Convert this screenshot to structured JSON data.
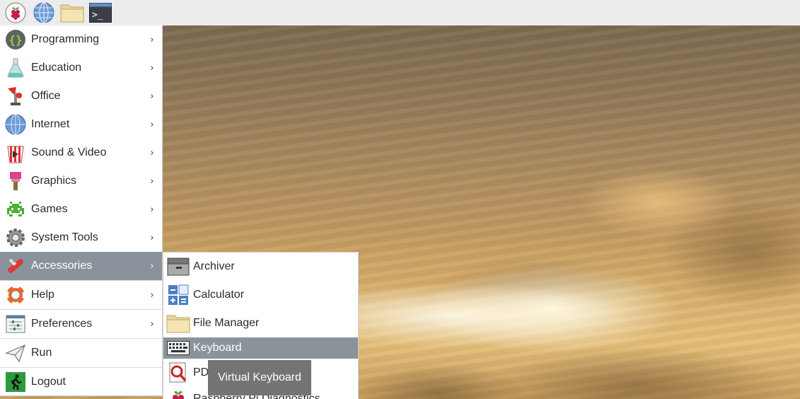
{
  "taskbar": {
    "launchers": [
      {
        "icon": "raspberry-menu-icon"
      },
      {
        "icon": "web-browser-icon"
      },
      {
        "icon": "file-manager-icon"
      },
      {
        "icon": "terminal-icon",
        "glyph": ">_"
      }
    ]
  },
  "menu": {
    "items": [
      {
        "label": "Programming",
        "icon": "programming-icon"
      },
      {
        "label": "Education",
        "icon": "education-icon"
      },
      {
        "label": "Office",
        "icon": "office-icon"
      },
      {
        "label": "Internet",
        "icon": "internet-icon"
      },
      {
        "label": "Sound & Video",
        "icon": "sound-video-icon"
      },
      {
        "label": "Graphics",
        "icon": "graphics-icon"
      },
      {
        "label": "Games",
        "icon": "games-icon"
      },
      {
        "label": "System Tools",
        "icon": "system-tools-icon"
      },
      {
        "label": "Accessories",
        "icon": "accessories-icon",
        "active": true
      },
      {
        "label": "Help",
        "icon": "help-icon"
      },
      {
        "label": "Preferences",
        "icon": "preferences-icon"
      },
      {
        "label": "Run",
        "icon": "run-icon"
      },
      {
        "label": "Logout",
        "icon": "logout-icon"
      }
    ],
    "arrow": "›"
  },
  "submenu": {
    "items": [
      {
        "label": "Archiver",
        "icon": "archiver-icon"
      },
      {
        "label": "Calculator",
        "icon": "calculator-icon"
      },
      {
        "label": "File Manager",
        "icon": "folder-icon"
      },
      {
        "label": "Keyboard",
        "icon": "keyboard-icon",
        "active": true
      },
      {
        "label": "PD",
        "icon": "pdf-viewer-icon"
      },
      {
        "label": "Raspberry Pi Diagnostics",
        "icon": "raspberry-icon"
      }
    ]
  },
  "tooltip": {
    "text": "Virtual Keyboard"
  },
  "colors": {
    "panel": "#edecec",
    "highlight": "#8a939c",
    "tooltip_bg": "#727476"
  }
}
